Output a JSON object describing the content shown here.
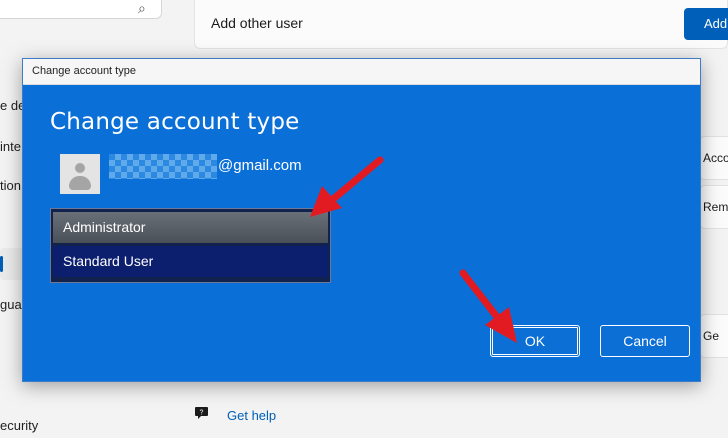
{
  "background": {
    "sidebar_items": [
      "e de",
      "inte",
      "tion",
      "guag",
      "ecurity"
    ],
    "add_other_user_label": "Add other user",
    "add_button_label": "Add",
    "right_cells": [
      "Accou",
      "Remo",
      "Ge"
    ],
    "get_help_label": "Get help"
  },
  "dialog": {
    "title": "Change account type",
    "heading": "Change account type",
    "email_suffix": "@gmail.com",
    "dropdown": {
      "options": [
        "Administrator",
        "Standard User"
      ],
      "highlighted": "Administrator"
    },
    "ok_label": "OK",
    "cancel_label": "Cancel"
  },
  "annotations": {
    "arrow_color": "#e21b23",
    "arrow_count": 2
  },
  "colors": {
    "dialog_blue": "#0a6fd6",
    "accent": "#005fb8",
    "dropdown_dark": "#12224f",
    "arrow_red": "#e21b23"
  }
}
